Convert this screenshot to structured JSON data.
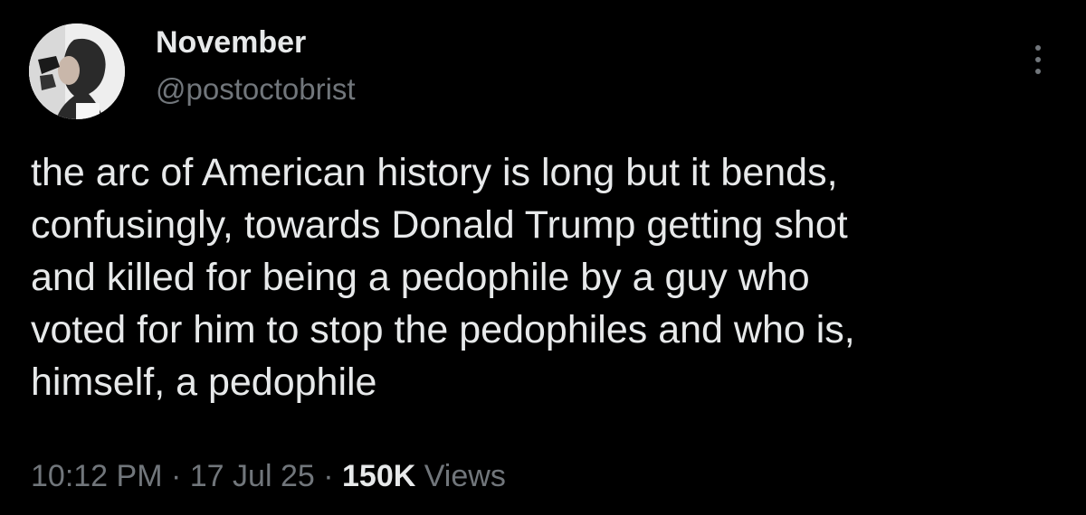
{
  "tweet": {
    "display_name": "November",
    "handle": "@postoctobrist",
    "text_lines": [
      "the arc of American history is long but it bends,",
      "confusingly, towards Donald Trump getting shot",
      "and killed for being a pedophile by a guy who",
      "voted for him to stop the pedophiles and who is,",
      "himself, a pedophile"
    ],
    "time": "10:12 PM",
    "separator": "·",
    "date": "17 Jul 25",
    "views_count": "150K",
    "views_label": "Views"
  },
  "icons": {
    "more": "more-options-icon"
  },
  "colors": {
    "background": "#000000",
    "primary_text": "#e7e9ea",
    "secondary_text": "#71767b"
  }
}
